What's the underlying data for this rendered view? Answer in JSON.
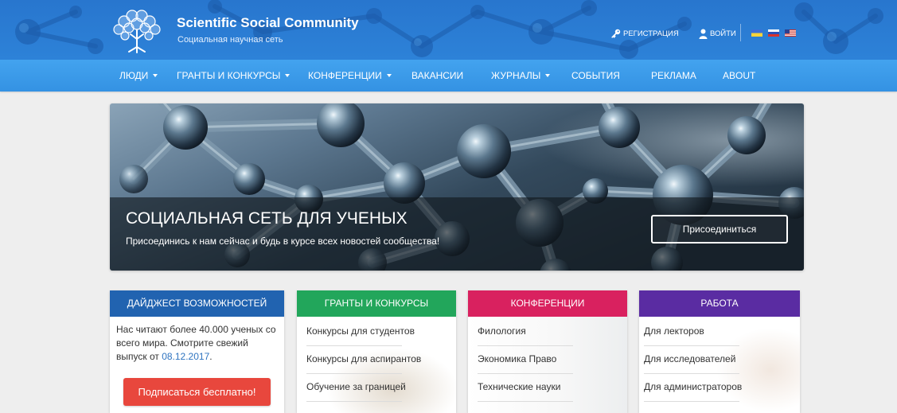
{
  "header": {
    "logo_icon": "tree-logo-icon",
    "site_title": "Scientific Social Community",
    "site_subtitle": "Социальная научная сеть",
    "brand_color": "#2b7fd4",
    "register": {
      "label": "РЕГИСТРАЦИЯ",
      "icon": "key-icon"
    },
    "login": {
      "label": "ВОЙТИ",
      "icon": "user-icon"
    },
    "language_flags": [
      "ukraine-flag-icon",
      "russia-flag-icon",
      "usa-flag-icon"
    ]
  },
  "nav": {
    "background_color": "#3a9ae8",
    "items": [
      {
        "label": "ЛЮДИ",
        "has_dropdown": true
      },
      {
        "label": "ГРАНТЫ И КОНКУРСЫ",
        "has_dropdown": true
      },
      {
        "label": "КОНФЕРЕНЦИИ",
        "has_dropdown": true
      },
      {
        "label": "ВАКАНСИИ",
        "has_dropdown": false
      },
      {
        "label": "ЖУРНАЛЫ",
        "has_dropdown": true
      },
      {
        "label": "СОБЫТИЯ",
        "has_dropdown": false
      },
      {
        "label": "РЕКЛАМА",
        "has_dropdown": false
      },
      {
        "label": "ABOUT",
        "has_dropdown": false
      }
    ]
  },
  "hero": {
    "title": "СОЦИАЛЬНАЯ СЕТЬ ДЛЯ УЧЕНЫХ",
    "subtitle": "Присоединись к нам сейчас и будь в курсе всех новостей сообщества!",
    "join_button_label": "Присоединиться"
  },
  "cards": {
    "digest": {
      "title": "ДАЙДЖЕСТ ВОЗМОЖНОСТЕЙ",
      "color": "#2163b0",
      "text": "Нас читают более 40.000 ученых со всего мира. Смотрите свежий выпуск от ",
      "issue_date": "08.12.2017",
      "text_end": ".",
      "subscribe_button_label": "Подписаться бесплатно!",
      "subscribe_button_color": "#e8473d"
    },
    "grants": {
      "title": "ГРАНТЫ И КОНКУРСЫ",
      "color": "#22a65b",
      "items": [
        "Конкурсы для студентов",
        "Конкурсы для аспирантов",
        "Обучение за границей"
      ]
    },
    "conferences": {
      "title": "КОНФЕРЕНЦИИ",
      "color": "#d9215f",
      "items": [
        "Филология",
        "Экономика Право",
        "Технические науки"
      ]
    },
    "jobs": {
      "title": "РАБОТА",
      "color": "#5a2ca2",
      "items": [
        "Для лекторов",
        "Для исследователей",
        "Для администраторов"
      ]
    }
  }
}
